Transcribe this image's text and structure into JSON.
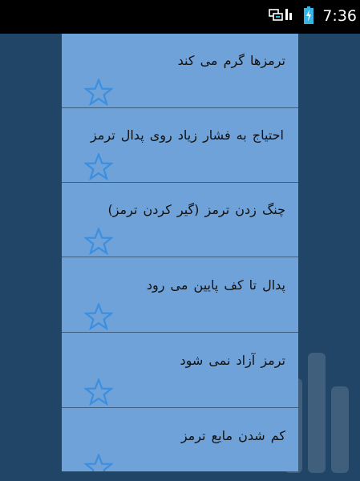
{
  "status_bar": {
    "time": "7:36",
    "icons": [
      "network-icon",
      "signal-icon",
      "battery-charging-icon"
    ]
  },
  "items": [
    {
      "title": "ترمزها گرم می کند",
      "favorite_icon": "star-outline-icon"
    },
    {
      "title": "احتیاج به فشار زیاد روی پدال ترمز",
      "favorite_icon": "star-outline-icon"
    },
    {
      "title": "چنگ زدن ترمز (گیر کردن ترمز)",
      "favorite_icon": "star-outline-icon"
    },
    {
      "title": "پدال تا کف پایین می رود",
      "favorite_icon": "star-outline-icon"
    },
    {
      "title": "ترمز آزاد نمی شود",
      "favorite_icon": "star-outline-icon"
    },
    {
      "title": "کم شدن مایع ترمز",
      "favorite_icon": "star-outline-icon"
    }
  ],
  "colors": {
    "background": "#214567",
    "list_background": "#6ea2d9",
    "divider": "#3c5d80",
    "star": "#3c8ede",
    "status_bar": "#000000",
    "accent": "#33b5e5"
  }
}
